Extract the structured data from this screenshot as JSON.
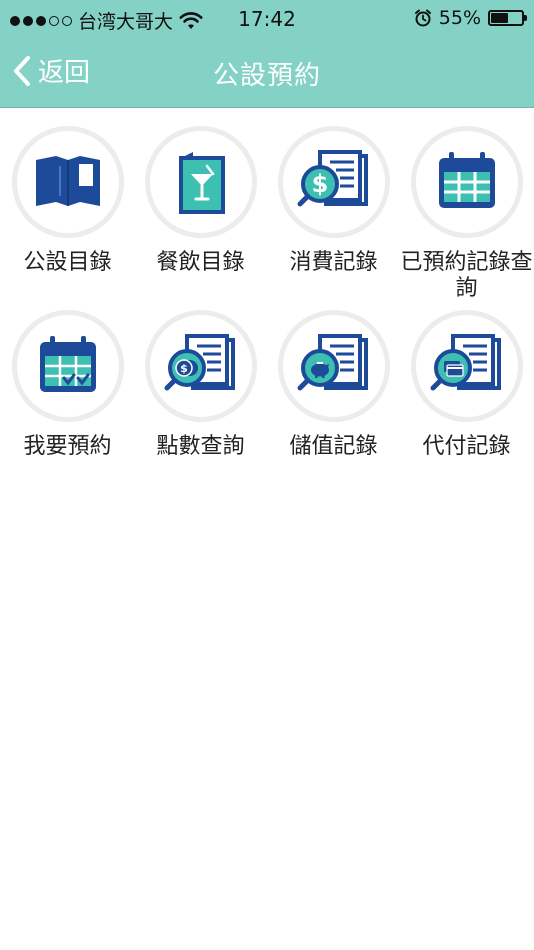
{
  "status_bar": {
    "carrier": "台湾大哥大",
    "time": "17:42",
    "battery": "55%",
    "signal_bars_filled": 3,
    "signal_bars_total": 5,
    "battery_level": 0.55
  },
  "nav": {
    "back_label": "返回",
    "title": "公設預約"
  },
  "colors": {
    "header": "#84d2c5",
    "icon_navy": "#1e4a9a",
    "icon_teal": "#3dbfb2"
  },
  "menu": {
    "items": [
      {
        "label": "公設目錄",
        "icon": "folder-icon"
      },
      {
        "label": "餐飲目錄",
        "icon": "drink-menu-icon"
      },
      {
        "label": "消費記錄",
        "icon": "dollar-record-icon"
      },
      {
        "label": "已預約記錄查詢",
        "icon": "calendar-icon"
      },
      {
        "label": "我要預約",
        "icon": "calendar-check-icon"
      },
      {
        "label": "點數查詢",
        "icon": "coin-record-icon"
      },
      {
        "label": "儲值記錄",
        "icon": "piggy-bank-record-icon"
      },
      {
        "label": "代付記錄",
        "icon": "card-record-icon"
      }
    ]
  }
}
